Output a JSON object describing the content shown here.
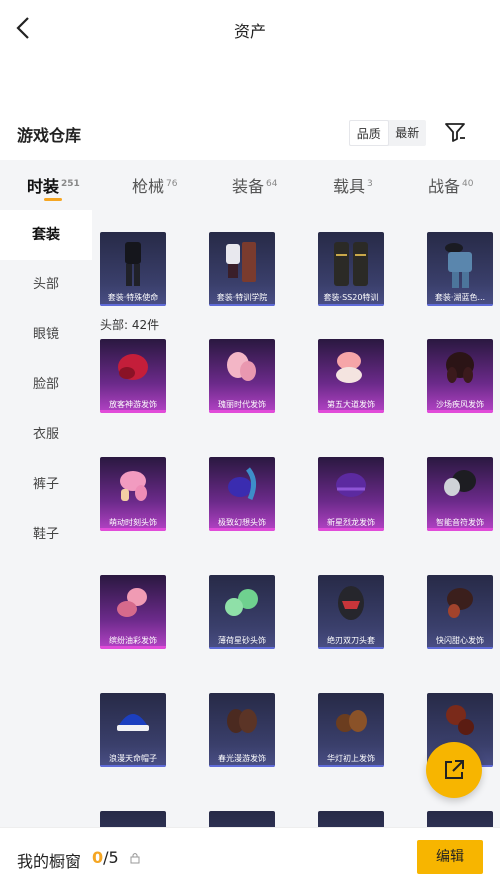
{
  "header": {
    "title": "资产",
    "back_icon": "chevron-left-icon"
  },
  "section": {
    "title": "游戏仓库",
    "sort_options": [
      "品质",
      "最新"
    ],
    "filter_icon": "filter-icon"
  },
  "tabs": [
    {
      "label": "时装",
      "count": "251"
    },
    {
      "label": "枪械",
      "count": "76"
    },
    {
      "label": "装备",
      "count": "64"
    },
    {
      "label": "载具",
      "count": "3"
    },
    {
      "label": "战备",
      "count": "40"
    }
  ],
  "sidebar": [
    "套装",
    "头部",
    "眼镜",
    "脸部",
    "衣服",
    "裤子",
    "鞋子"
  ],
  "suits": [
    "套装·特殊使命",
    "套装·特训学院",
    "套装·SS20特训",
    "套装·湖蓝色..."
  ],
  "head_section": {
    "label": "头部: 42件"
  },
  "head_items": [
    "放客神游发饰",
    "瑰丽时代发饰",
    "第五大道发饰",
    "沙场疾风发饰",
    "萌动时刻头饰",
    "极致幻想头饰",
    "新星烈龙发饰",
    "智能音符发饰",
    "缤纷油彩发饰",
    "薄荷星砂头饰",
    "绝刃双刀头套",
    "快闪甜心发饰",
    "浪漫天命帽子",
    "春光漫游发饰",
    "华灯初上发饰",
    ""
  ],
  "bottom": {
    "title": "我的橱窗",
    "current": "0",
    "total": "/5",
    "edit_label": "编辑"
  },
  "colors": {
    "accent": "#f7b500",
    "purple_quality": "#e14bd9",
    "blue_quality": "#5f6bd8"
  }
}
